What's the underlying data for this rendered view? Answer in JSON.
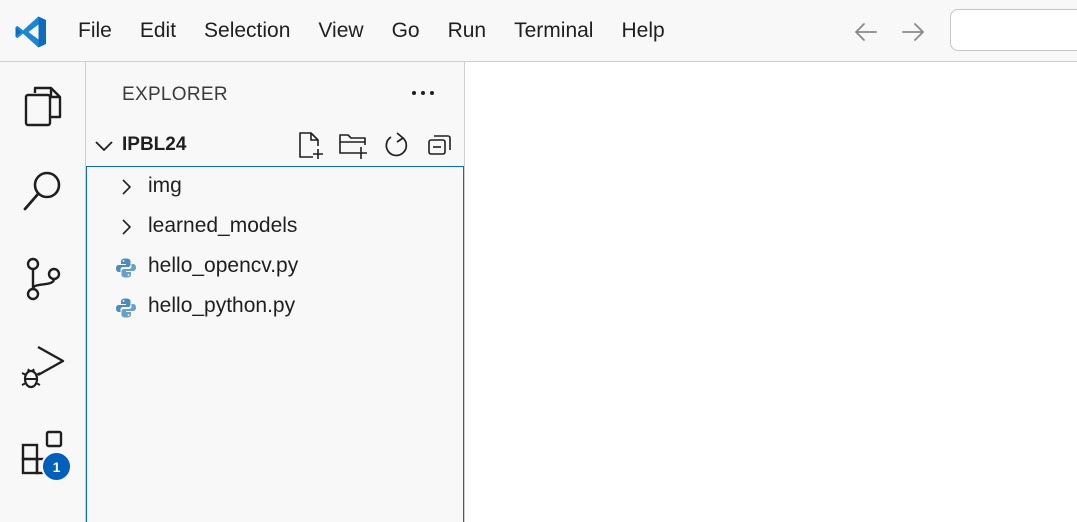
{
  "menu": {
    "items": [
      "File",
      "Edit",
      "Selection",
      "View",
      "Go",
      "Run",
      "Terminal",
      "Help"
    ]
  },
  "nav": {
    "back_icon": "arrow-left-icon",
    "forward_icon": "arrow-right-icon"
  },
  "activity_bar": {
    "items": [
      "explorer-icon",
      "search-icon",
      "source-control-icon",
      "run-debug-icon",
      "extensions-icon"
    ],
    "extensions_badge": "1"
  },
  "sidebar": {
    "title": "EXPLORER",
    "folder": {
      "name": "IPBL24",
      "actions": [
        "new-file-icon",
        "new-folder-icon",
        "refresh-icon",
        "collapse-all-icon"
      ]
    },
    "tree": [
      {
        "label": "img",
        "type": "folder"
      },
      {
        "label": "learned_models",
        "type": "folder"
      },
      {
        "label": "hello_opencv.py",
        "type": "python-file"
      },
      {
        "label": "hello_python.py",
        "type": "python-file"
      }
    ]
  },
  "colors": {
    "accent": "#0f6cbd",
    "badge": "#005fb8",
    "vscode_logo": "#0065a9",
    "python_icon": "#4b8bbe"
  }
}
